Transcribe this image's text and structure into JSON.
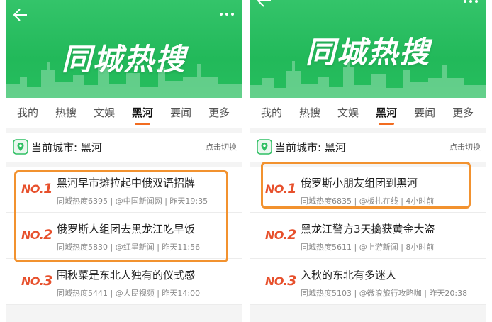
{
  "banner_title": "同城热搜",
  "tabs": [
    "我的",
    "热搜",
    "文娱",
    "黑河",
    "要闻",
    "更多"
  ],
  "active_tab": "黑河",
  "city": {
    "label": "当前城市: 黑河",
    "switch": "点击切换"
  },
  "left": {
    "items": [
      {
        "rank_prefix": "NO.",
        "rank_num": "1",
        "title": "黑河早市摊拉起中俄双语招牌",
        "meta": "同城热度6395 | @中国新闻网 | 昨天19:35"
      },
      {
        "rank_prefix": "NO.",
        "rank_num": "2",
        "title": "俄罗斯人组团去黑龙江吃早饭",
        "meta": "同城热度5830 | @红星新闻 | 昨天11:56"
      },
      {
        "rank_prefix": "NO.",
        "rank_num": "3",
        "title": "围秋菜是东北人独有的仪式感",
        "meta": "同城热度5441 | @人民视频 | 昨天14:00"
      }
    ]
  },
  "right": {
    "items": [
      {
        "rank_prefix": "NO.",
        "rank_num": "1",
        "title": "俄罗斯小朋友组团到黑河",
        "meta": "同城热度6835 | @板扎在线 | 4小时前"
      },
      {
        "rank_prefix": "NO.",
        "rank_num": "2",
        "title": "黑龙江警方3天擒获黄金大盗",
        "meta": "同城热度5611 | @上游新闻 | 8小时前"
      },
      {
        "rank_prefix": "NO.",
        "rank_num": "3",
        "title": "入秋的东北有多迷人",
        "meta": "同城热度5103 | @微浪旅行攻略咖 | 昨天20:38"
      }
    ]
  },
  "colors": {
    "banner_green": "#22b95a",
    "accent_orange": "#f26c20",
    "rank_red": "#e7502c",
    "highlight_orange": "#f2922f"
  },
  "icons": [
    "back-arrow-icon",
    "more-dots-icon",
    "location-pin-icon"
  ]
}
